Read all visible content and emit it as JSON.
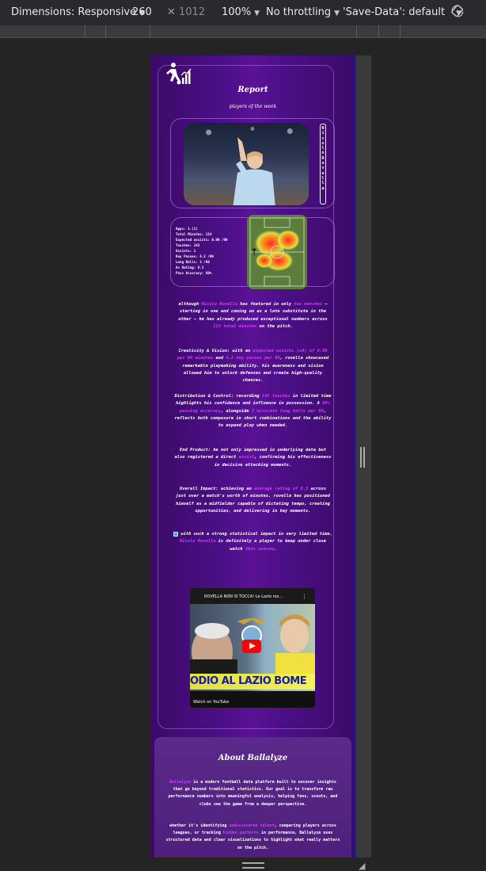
{
  "devtools": {
    "dimensions_label": "Dimensions: Responsive",
    "width_value": "260",
    "height_placeholder": "1012",
    "zoom": "100%",
    "throttling": "No throttling",
    "save_data": "'Save-Data': default"
  },
  "report": {
    "title": "Report",
    "subtitle": "players of the week",
    "player_name_vertical": "Nicolo Rovella"
  },
  "stats": [
    "Apps: 1-(1)",
    "Total Minutes: 114",
    "Expected assists: 0.90 /90",
    "Touches: 142",
    "Assists: 1",
    "Key Passes: 4.2 /90",
    "Long Balls: 3 /90",
    "Av Rating: 8.3",
    "Pass Accuracy: 80%"
  ],
  "paragraphs": {
    "p1_a": "although ",
    "p1_name": "Nicolo Rovella",
    "p1_b": " has featured in only ",
    "p1_matches": "two matches",
    "p1_c": " — starting in one and coming on as a late substitute in the other — he has already produced exceptional numbers across ",
    "p1_minutes": "114 total minutes",
    "p1_d": " on the pitch.",
    "p2_a": "Creativity & Vision: with an ",
    "p2_xa": "expected assists (xA) of 0.90 per 90 minutes",
    "p2_b": " and ",
    "p2_kp": "4.2 key passes per 90",
    "p2_c": ", rovella showcased remarkable playmaking ability. his awareness and vision allowed him to unlock defenses and create high-quality chances.",
    "p3_a": "Distribution & Control: recording ",
    "p3_touches": "142 touches",
    "p3_b": " in limited time highlights his confidence and influence in possession. A ",
    "p3_acc": "80% passing accuracy",
    "p3_c": ", alongside ",
    "p3_long": "3 accurate long balls per 90",
    "p3_d": ", reflects both composure in short combinations and the ability to expand play when needed.",
    "p4_a": "End Product: he not only impressed in underlying data but also registered a direct ",
    "p4_assist": "assist",
    "p4_b": ", confirming his effectiveness in decisive attacking moments.",
    "p5_a": "Overall Impact: achieving an ",
    "p5_rating": "average rating of 8.3",
    "p5_b": " across just over a match's worth of minutes, rovella has positioned himself as a midfielder capable of dictating tempo, creating opportunities, and delivering in key moments.",
    "p6_a": " with such a strong statistical impact in very limited time, ",
    "p6_name": "Nicolo Rovella",
    "p6_b": " is definitely a player to keep under close watch ",
    "p6_season": "this season",
    "p6_c": "."
  },
  "video": {
    "title": "ROVELLA NON SI TOCCA! Le Lazio res...",
    "banner": "ODIO AL LAZIO BOME",
    "watch_on": "Watch on  YouTube"
  },
  "about": {
    "title": "About Ballalyze",
    "brand": "Ballalyze",
    "p1": " is a modern football data platform built to uncover insights that go beyond traditional statistics. Our goal is to transform raw performance numbers into meaningful analysis, helping fans, scouts, and clubs see the game from a deeper perspective.",
    "p2_a": "whether it's identifying ",
    "p2_talent": "undiscovered talent",
    "p2_b": ", comparing players across leagues, or tracking ",
    "p2_patterns": "hidden patterns",
    "p2_c": " in performance, Ballalyze uses structured data and clear visualizations to highlight what really matters on the pitch."
  },
  "colors": {
    "highlight": "#d23cff",
    "viewport_bg": "#4c0f86"
  }
}
